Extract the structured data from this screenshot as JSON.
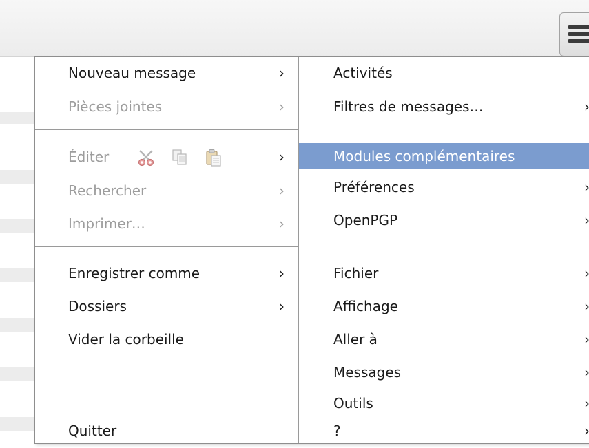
{
  "toolbar": {
    "menu_button_icon": "hamburger-icon"
  },
  "menu": {
    "left_column": [
      {
        "label": "Nouveau message",
        "arrow": "›",
        "enabled": true
      },
      {
        "label": "Pièces jointes",
        "arrow": "›",
        "enabled": false
      },
      {
        "label": "Éditer",
        "arrow": "›",
        "enabled": false,
        "icons": [
          "scissors-icon",
          "copy-icon",
          "paste-icon"
        ]
      },
      {
        "label": "Rechercher",
        "arrow": "›",
        "enabled": false
      },
      {
        "label": "Imprimer…",
        "arrow": "›",
        "enabled": false
      },
      {
        "label": "Enregistrer comme",
        "arrow": "›",
        "enabled": true
      },
      {
        "label": "Dossiers",
        "arrow": "›",
        "enabled": true
      },
      {
        "label": "Vider la corbeille",
        "enabled": true
      },
      {
        "label": "Quitter",
        "enabled": true
      }
    ],
    "right_column": [
      {
        "label": "Activités"
      },
      {
        "label": "Filtres de messages…",
        "arrow": "›"
      },
      {
        "label": "Modules complémentaires",
        "highlighted": true
      },
      {
        "label": "Préférences",
        "arrow": "›"
      },
      {
        "label": "OpenPGP",
        "arrow": "›"
      },
      {
        "label": "Fichier",
        "arrow": "›"
      },
      {
        "label": "Affichage",
        "arrow": "›"
      },
      {
        "label": "Aller à",
        "arrow": "›"
      },
      {
        "label": "Messages",
        "arrow": "›"
      },
      {
        "label": "Outils",
        "arrow": "›"
      },
      {
        "label": "?",
        "arrow": "›"
      }
    ]
  },
  "colors": {
    "highlight": "#7b9ccf",
    "disabled_text": "#9d9d9d",
    "text": "#1a1a1a"
  }
}
